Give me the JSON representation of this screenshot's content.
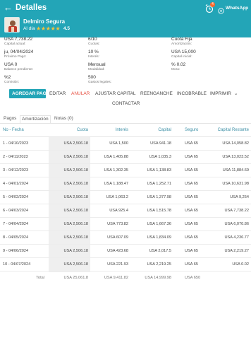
{
  "header": {
    "title": "Detalles",
    "client_name": "Delmiro Segura",
    "status": "Al día",
    "stars": "★★★★★",
    "rating": "4.5",
    "notification_count": "4",
    "whatsapp_label": "WhatsApp"
  },
  "info": {
    "capital_actual": {
      "value": "USA 7,738.22",
      "label": "Capital actual:"
    },
    "cuotas": {
      "value": "6/10",
      "label": "Cuotas:"
    },
    "amortizacion": {
      "value": "Cuota Fija",
      "label": "Amortización:"
    },
    "proximo_pago": {
      "value": "ju, 04/04/2024",
      "label": "Próximo Pago:"
    },
    "interes": {
      "value": "10 %",
      "label": "Interés:"
    },
    "capital_inicial": {
      "value": "USA 15,000",
      "label": "Capital inicial:"
    },
    "balance_pendiente": {
      "value": "USA 0",
      "label": "Balance pendiente:"
    },
    "modalidad": {
      "value": "Mensual",
      "label": "Modalidad:"
    },
    "mora": {
      "value": "% 0.02",
      "label": "Mora:"
    },
    "comision": {
      "value": "%2",
      "label": "Comisión:"
    },
    "gastos_legales": {
      "value": "500",
      "label": "Gastos legales:"
    }
  },
  "actions": {
    "agregar_pago": "AGREGAR PAGO",
    "editar": "EDITAR",
    "anular": "ANULAR",
    "ajustar_capital": "AJUSTAR CAPITAL",
    "reenganche": "REENGANCHE",
    "incobrable": "INCOBRABLE",
    "imprimir": "IMPRIMIR",
    "contactar": "CONTACTAR"
  },
  "tabs": [
    {
      "label": "Pagos"
    },
    {
      "label": "Amortización",
      "active": true
    },
    {
      "label": "Notas (0)"
    }
  ],
  "table": {
    "columns": [
      "No - Fecha",
      "Cuota",
      "Interés",
      "Capital",
      "Seguro",
      "Capital Restante"
    ],
    "rows": [
      [
        "1 - 04/10/2023",
        "USA 2,506.18",
        "USA 1,500",
        "USA 941.18",
        "USA 65",
        "USA 14,058.82"
      ],
      [
        "2 - 04/11/2023",
        "USA 2,506.18",
        "USA 1,405.88",
        "USA 1,035.3",
        "USA 65",
        "USA 13,023.52"
      ],
      [
        "3 - 04/12/2023",
        "USA 2,506.18",
        "USA 1,302.35",
        "USA 1,138.83",
        "USA 65",
        "USA 11,884.69"
      ],
      [
        "4 - 04/01/2024",
        "USA 2,506.18",
        "USA 1,188.47",
        "USA 1,252.71",
        "USA 65",
        "USA 10,631.98"
      ],
      [
        "5 - 04/02/2024",
        "USA 2,506.18",
        "USA 1,063.2",
        "USA 1,377.98",
        "USA 65",
        "USA 9,254"
      ],
      [
        "6 - 04/03/2024",
        "USA 2,506.18",
        "USA 925.4",
        "USA 1,515.78",
        "USA 65",
        "USA 7,738.22"
      ],
      [
        "7 - 04/04/2024",
        "USA 2,506.18",
        "USA 773.82",
        "USA 1,667.36",
        "USA 65",
        "USA 6,070.86"
      ],
      [
        "8 - 04/05/2024",
        "USA 2,506.18",
        "USA 607.09",
        "USA 1,834.09",
        "USA 65",
        "USA 4,236.77"
      ],
      [
        "9 - 04/06/2024",
        "USA 2,506.18",
        "USA 423.68",
        "USA 2,017.5",
        "USA 65",
        "USA 2,219.27"
      ],
      [
        "10 - 04/07/2024",
        "USA 2,506.18",
        "USA 221.93",
        "USA 2,219.25",
        "USA 65",
        "USA 0.02"
      ]
    ],
    "total": [
      "Total",
      "USA 25,061.8",
      "USA 9,411.82",
      "USA 14,999.98",
      "USA 650",
      ""
    ]
  },
  "colors": {
    "primary": "#23a5b7",
    "anular": "#e64a3b",
    "stars": "#f6c23a",
    "badge": "#ff6a2b"
  }
}
